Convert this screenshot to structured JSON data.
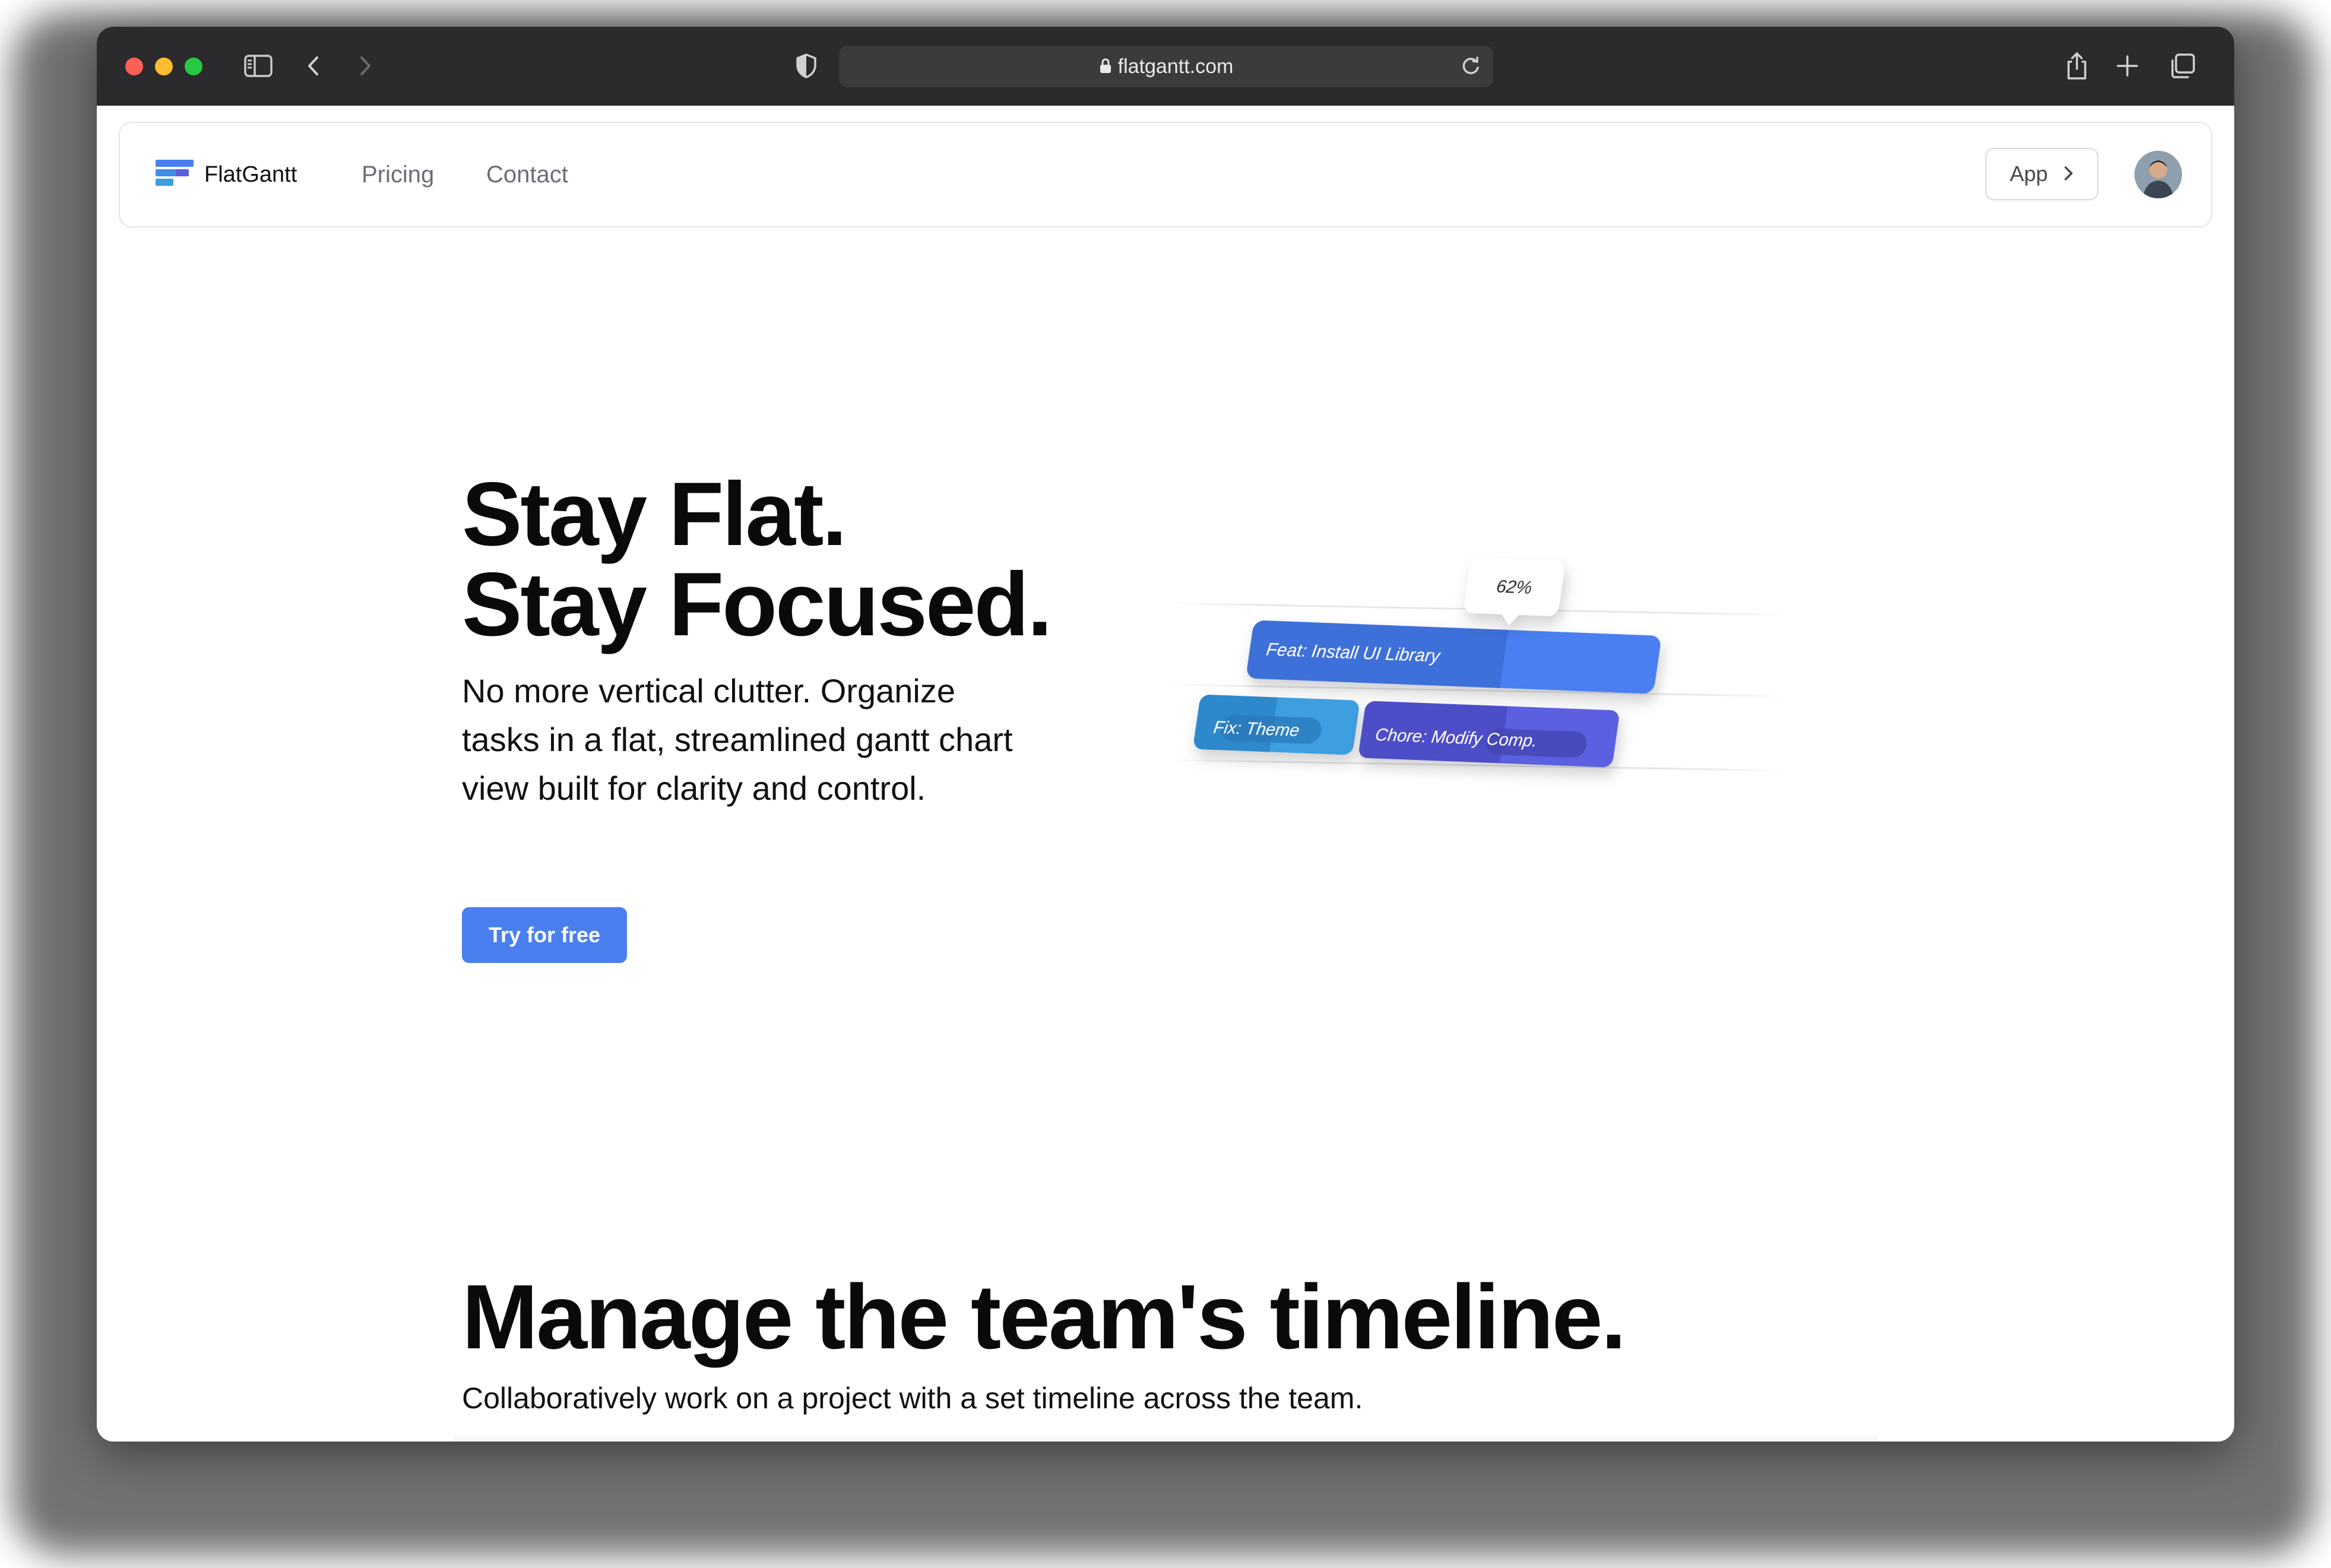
{
  "browser": {
    "url": "flatgantt.com"
  },
  "nav": {
    "brand": "FlatGantt",
    "links": [
      "Pricing",
      "Contact"
    ],
    "app_button": "App"
  },
  "hero": {
    "title_line1": "Stay Flat.",
    "title_line2": "Stay Focused.",
    "subtitle": "No more vertical clutter. Organize tasks in a flat, streamlined gantt chart view built for clarity and control.",
    "cta": "Try for free"
  },
  "illustration": {
    "progress_label": "62%",
    "progress": 0.62,
    "tasks": [
      {
        "label": "Feat: Install UI Library",
        "color": "#4a7ff0"
      },
      {
        "label": "Fix: Theme",
        "color": "#3d9ee0"
      },
      {
        "label": "Chore: Modify Comp.",
        "color": "#5b5fe0"
      }
    ]
  },
  "section2": {
    "title": "Manage the team's timeline.",
    "subtitle": "Collaboratively work on a project with a set timeline across the team."
  },
  "colors": {
    "accent": "#4a7ff0",
    "toolbar": "#2b2b2d"
  }
}
